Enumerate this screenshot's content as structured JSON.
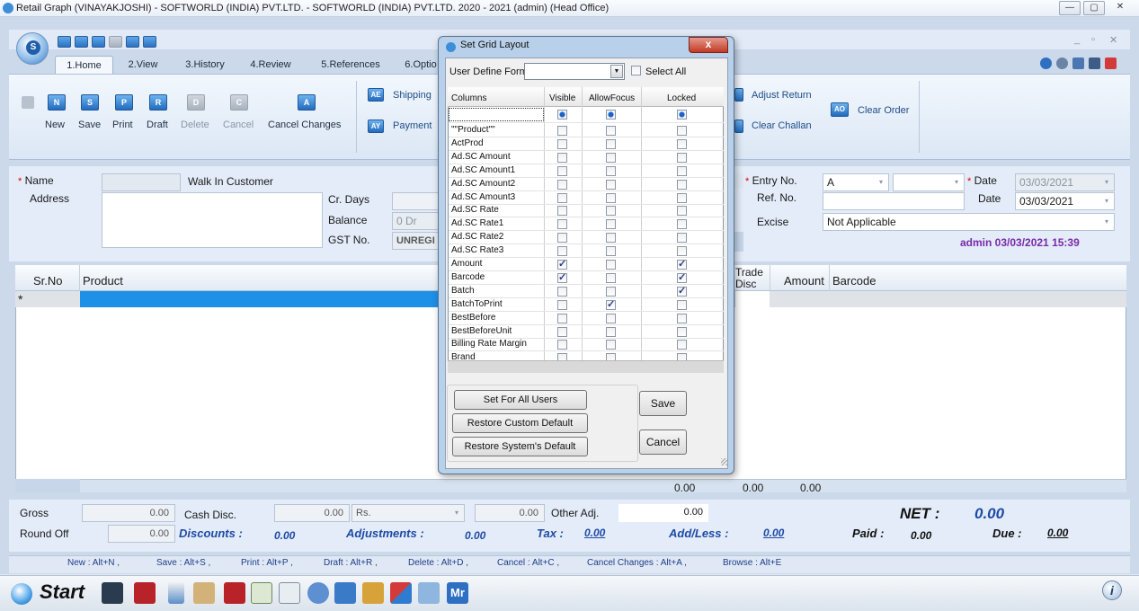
{
  "window": {
    "title": "Retail Graph (VINAYAKJOSHI) - SOFTWORLD (INDIA) PVT.LTD. - SOFTWORLD (INDIA) PVT.LTD.  2020 - 2021 (admin) (Head Office)"
  },
  "tabs": [
    "1.Home",
    "2.View",
    "3.History",
    "4.Review",
    "5.References",
    "6.Optio"
  ],
  "ribbon": {
    "buttons": [
      {
        "icon": "N",
        "label": "New"
      },
      {
        "icon": "S",
        "label": "Save"
      },
      {
        "icon": "P",
        "label": "Print"
      },
      {
        "icon": "R",
        "label": "Draft"
      },
      {
        "icon": "D",
        "label": "Delete"
      },
      {
        "icon": "C",
        "label": "Cancel"
      },
      {
        "icon": "A",
        "label": "Cancel Changes"
      }
    ],
    "shipping": "Shipping",
    "payment": "Payment",
    "adjust_return": "Adjust Return",
    "clear_challan": "Clear Challan",
    "clear_order": "Clear Order",
    "shipping_icon": "AE",
    "payment_icon": "AY",
    "clear_order_icon": "AO"
  },
  "form": {
    "name_label": "Name",
    "name_value": "Walk In Customer",
    "address_label": "Address",
    "cr_days_label": "Cr. Days",
    "balance_label": "Balance",
    "balance_value": "0 Dr",
    "gst_label": "GST No.",
    "gst_value": "UNREGI",
    "entry_no_label": "Entry No.",
    "entry_no_value": "A",
    "ref_no_label": "Ref. No.",
    "excise_label": "Excise",
    "excise_value": "Not Applicable",
    "date_label": "Date",
    "date1_value": "03/03/2021",
    "date2_value": "03/03/2021",
    "user_stamp": "admin 03/03/2021 15:39"
  },
  "grid": {
    "columns": {
      "srno": "Sr.No",
      "product": "Product",
      "trade_disc": "Trade Disc",
      "amount": "Amount",
      "barcode": "Barcode"
    },
    "new_row_marker": "*",
    "footer": [
      "0.00",
      "0.00",
      "0.00"
    ]
  },
  "totals": {
    "gross_label": "Gross",
    "gross_value": "0.00",
    "cash_disc_label": "Cash Disc.",
    "cash_disc_value": "0.00",
    "rs_label": "Rs.",
    "rs_value": "0.00",
    "other_adj_label": "Other Adj.",
    "other_adj_value": "0.00",
    "net_label": "NET :",
    "net_value": "0.00",
    "round_off_label": "Round Off",
    "round_off_value": "0.00",
    "discounts_label": "Discounts :",
    "discounts_value": "0.00",
    "adjustments_label": "Adjustments :",
    "adjustments_value": "0.00",
    "tax_label": "Tax :",
    "tax_value": "0.00",
    "addless_label": "Add/Less :",
    "addless_value": "0.00",
    "paid_label": "Paid :",
    "paid_value": "0.00",
    "due_label": "Due :",
    "due_value": "0.00"
  },
  "shortcuts": [
    "New : Alt+N ,",
    "Save : Alt+S ,",
    "Print : Alt+P ,",
    "Draft : Alt+R ,",
    "Delete : Alt+D ,",
    "Cancel : Alt+C ,",
    "Cancel Changes : Alt+A ,",
    "Browse : Alt+E"
  ],
  "taskbar": {
    "start": "Start",
    "mr": "Mr"
  },
  "dialog": {
    "title": "Set Grid Layout",
    "close": "x",
    "user_define_form_label": "User Define Form",
    "select_all_label": "Select All",
    "headers": {
      "columns": "Columns",
      "visible": "Visible",
      "allowfocus": "AllowFocus",
      "locked": "Locked"
    },
    "rows": [
      {
        "name": "\"\"Product\"\"",
        "visible": false,
        "focus": false,
        "locked": false
      },
      {
        "name": "ActProd",
        "visible": false,
        "focus": false,
        "locked": false
      },
      {
        "name": "Ad.SC Amount",
        "visible": false,
        "focus": false,
        "locked": false
      },
      {
        "name": "Ad.SC Amount1",
        "visible": false,
        "focus": false,
        "locked": false
      },
      {
        "name": "Ad.SC Amount2",
        "visible": false,
        "focus": false,
        "locked": false
      },
      {
        "name": "Ad.SC Amount3",
        "visible": false,
        "focus": false,
        "locked": false
      },
      {
        "name": "Ad.SC Rate",
        "visible": false,
        "focus": false,
        "locked": false
      },
      {
        "name": "Ad.SC Rate1",
        "visible": false,
        "focus": false,
        "locked": false
      },
      {
        "name": "Ad.SC Rate2",
        "visible": false,
        "focus": false,
        "locked": false
      },
      {
        "name": "Ad.SC Rate3",
        "visible": false,
        "focus": false,
        "locked": false
      },
      {
        "name": "Amount",
        "visible": true,
        "focus": false,
        "locked": true
      },
      {
        "name": "Barcode",
        "visible": true,
        "focus": false,
        "locked": true
      },
      {
        "name": "Batch",
        "visible": false,
        "focus": false,
        "locked": true
      },
      {
        "name": "BatchToPrint",
        "visible": false,
        "focus": true,
        "locked": false
      },
      {
        "name": "BestBefore",
        "visible": false,
        "focus": false,
        "locked": false
      },
      {
        "name": "BestBeforeUnit",
        "visible": false,
        "focus": false,
        "locked": false
      },
      {
        "name": "Billing Rate Margin",
        "visible": false,
        "focus": false,
        "locked": false
      },
      {
        "name": "Brand",
        "visible": false,
        "focus": false,
        "locked": false
      }
    ],
    "set_for_all_users": "Set For All Users",
    "restore_custom": "Restore Custom Default",
    "restore_system": "Restore System's Default",
    "save": "Save",
    "cancel": "Cancel"
  },
  "colors": {
    "accent": "#1e90e8",
    "link": "#1f4aa5",
    "user_stamp": "#7a2aa8"
  }
}
